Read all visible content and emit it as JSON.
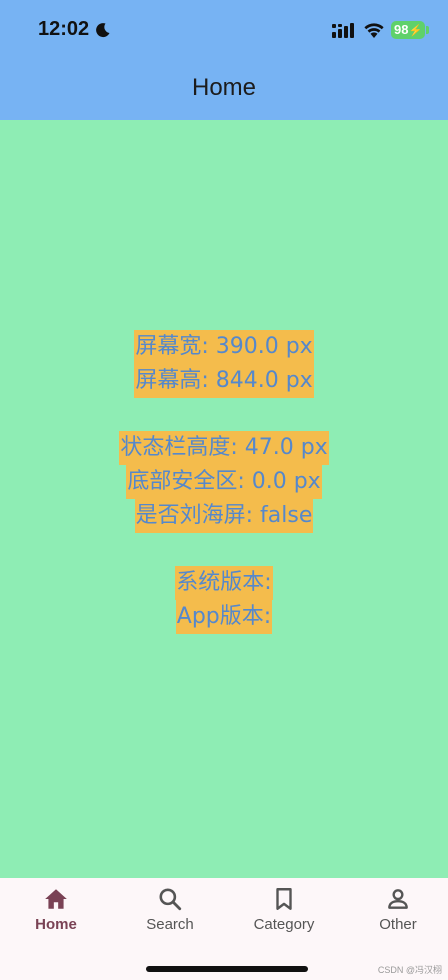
{
  "status_bar": {
    "time": "12:02",
    "battery": "98",
    "icons": [
      "moon-icon",
      "signal-icon",
      "wifi-icon",
      "battery-icon"
    ]
  },
  "app_bar": {
    "title": "Home"
  },
  "info": {
    "screen_width": "屏幕宽: 390.0 px",
    "screen_height": "屏幕高: 844.0 px",
    "status_bar_height": "状态栏高度: 47.0 px",
    "bottom_safe_area": "底部安全区: 0.0 px",
    "is_notch": "是否刘海屏: false",
    "system_version": "系统版本:",
    "app_version": "App版本:"
  },
  "bottom_nav": {
    "items": [
      {
        "label": "Home",
        "icon": "home-icon",
        "active": true
      },
      {
        "label": "Search",
        "icon": "search-icon",
        "active": false
      },
      {
        "label": "Category",
        "icon": "bookmark-icon",
        "active": false
      },
      {
        "label": "Other",
        "icon": "person-icon",
        "active": false
      }
    ]
  },
  "watermark": "CSDN @冯汉栩",
  "colors": {
    "app_bar": "#77b3f3",
    "background": "#8eedb4",
    "highlight": "#f4bc4c",
    "text": "#5588cc",
    "nav_active": "#7a4255"
  }
}
